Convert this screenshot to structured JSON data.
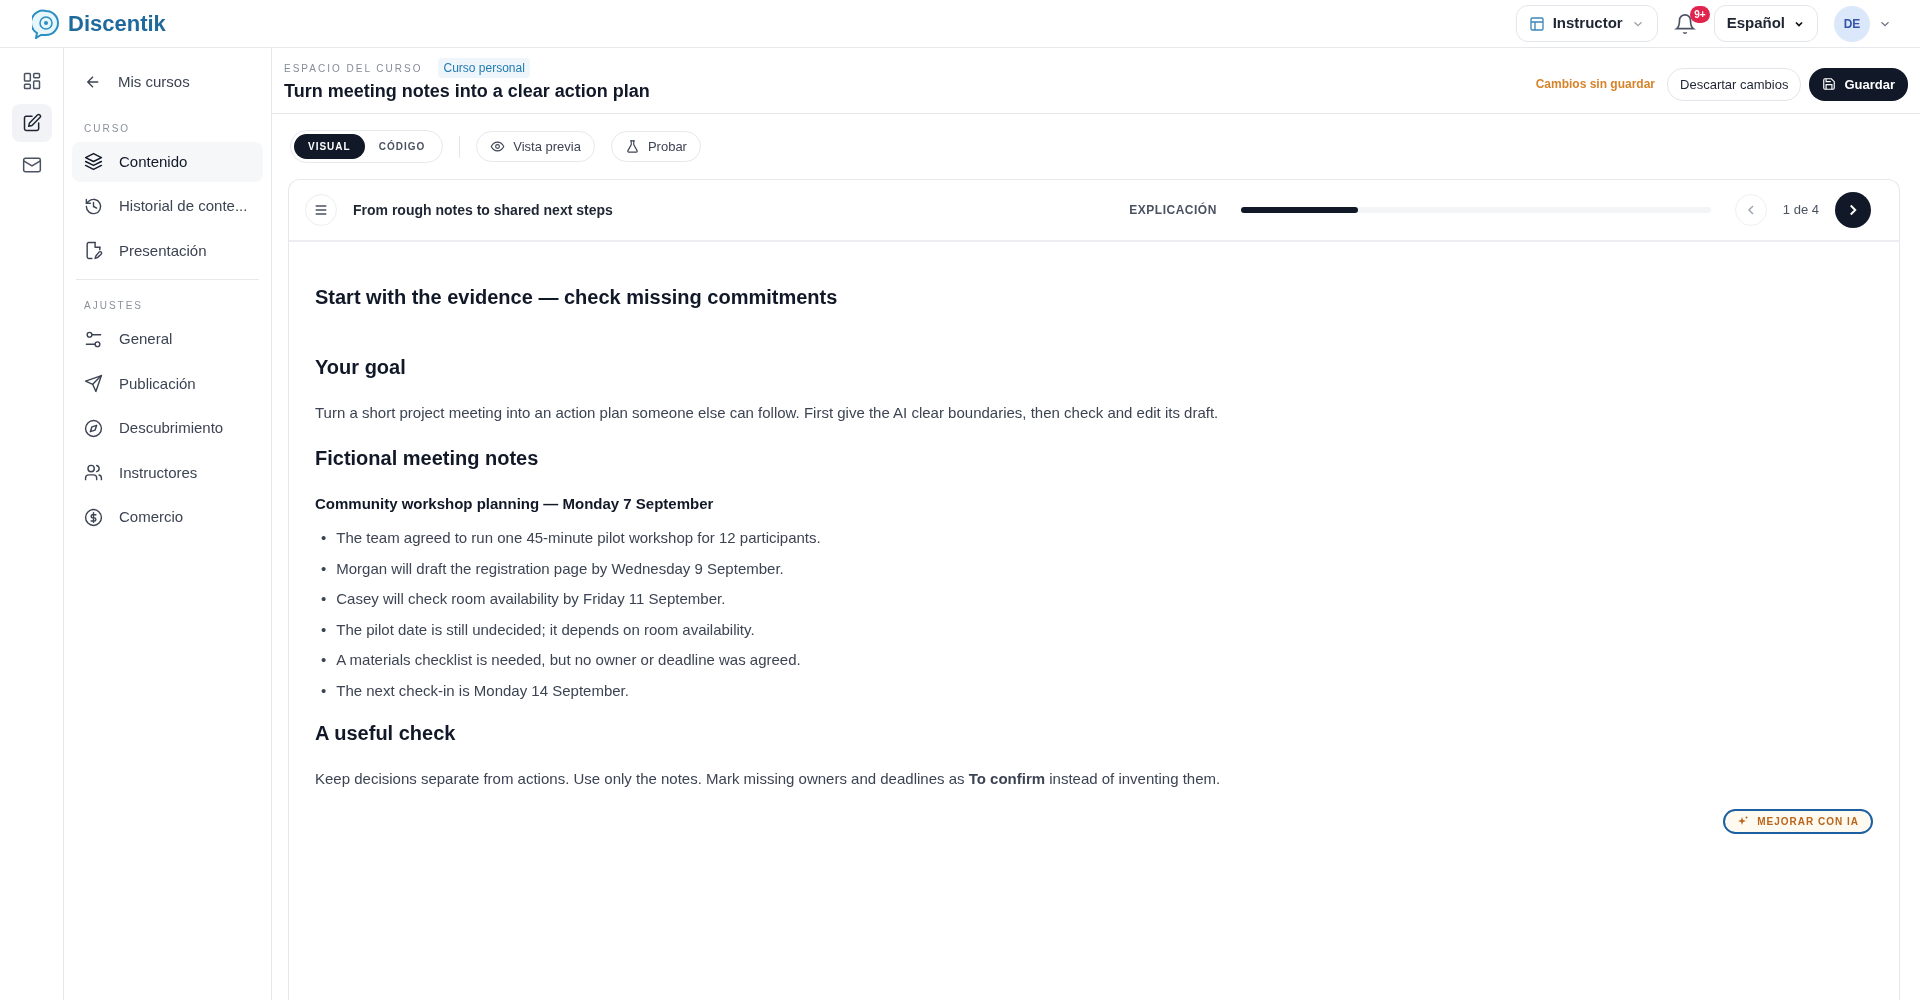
{
  "brand": {
    "name": "Discentik"
  },
  "topbar": {
    "role": "Instructor",
    "notifications": "9+",
    "language": "Español",
    "avatar": "DE"
  },
  "rail": [
    {
      "kind": "dashboard",
      "selected": false
    },
    {
      "kind": "edit",
      "selected": true
    },
    {
      "kind": "mail",
      "selected": false
    }
  ],
  "sidebar": {
    "back_link": "Mis cursos",
    "sections": [
      {
        "title": "CURSO",
        "items": [
          {
            "kind": "layers",
            "label": "Contenido",
            "selected": true
          },
          {
            "kind": "history",
            "label": "Historial de conte...",
            "selected": false
          },
          {
            "kind": "presentation",
            "label": "Presentación",
            "selected": false
          }
        ]
      },
      {
        "title": "AJUSTES",
        "items": [
          {
            "kind": "sliders",
            "label": "General",
            "selected": false
          },
          {
            "kind": "send",
            "label": "Publicación",
            "selected": false
          },
          {
            "kind": "compass",
            "label": "Descubrimiento",
            "selected": false
          },
          {
            "kind": "users",
            "label": "Instructores",
            "selected": false
          },
          {
            "kind": "dollar",
            "label": "Comercio",
            "selected": false
          }
        ]
      }
    ]
  },
  "page_header": {
    "eyebrow": "ESPACIO DEL CURSO",
    "badge": "Curso personal",
    "title": "Turn meeting notes into a clear action plan",
    "status": "Cambios sin guardar",
    "discard_button": "Descartar cambios",
    "save_button": "Guardar"
  },
  "toolbar": {
    "modes": [
      {
        "label": "VISUAL",
        "selected": true
      },
      {
        "label": "CÓDIGO",
        "selected": false
      }
    ],
    "actions": [
      {
        "kind": "preview",
        "label": "Vista previa"
      },
      {
        "kind": "test",
        "label": "Probar"
      }
    ]
  },
  "lesson": {
    "title": "From rough notes to shared next steps",
    "step_type": "EXPLICACIÓN",
    "level": 0.25,
    "pager": "1 de 4",
    "prev_disabled": true,
    "blocks": [
      {
        "kind": "title",
        "text": "Start with the evidence — check missing commitments"
      },
      {
        "kind": "heading",
        "text": "Your goal"
      },
      {
        "kind": "paragraph",
        "text": "Turn a short project meeting into an action plan someone else can follow. First give the AI clear boundaries, then check and edit its draft."
      },
      {
        "kind": "heading",
        "text": "Fictional meeting notes"
      },
      {
        "kind": "subheading",
        "text": "Community workshop planning — Monday 7 September"
      },
      {
        "kind": "list",
        "marker": "•",
        "items": [
          "The team agreed to run one 45-minute pilot workshop for 12 participants.",
          "Morgan will draft the registration page by Wednesday 9 September.",
          "Casey will check room availability by Friday 11 September.",
          "The pilot date is still undecided; it depends on room availability.",
          "A materials checklist is needed, but no owner or deadline was agreed.",
          "The next check-in is Monday 14 September."
        ]
      },
      {
        "kind": "heading",
        "text": "A useful check"
      },
      {
        "kind": "paragraph",
        "text": "Keep decisions separate from actions. Use only the notes. Mark missing owners and deadlines as **To confirm** instead of inventing them."
      }
    ],
    "ai_button": "MEJORAR CON IA"
  }
}
